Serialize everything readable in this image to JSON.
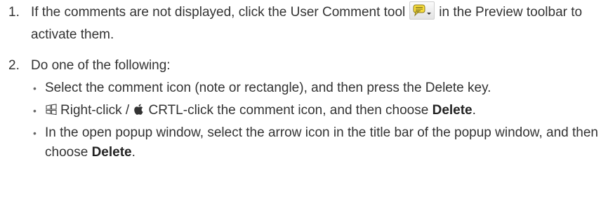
{
  "steps": [
    {
      "number": "1.",
      "text_before_icon": "If the comments are not displayed, click the User Comment tool",
      "text_after_icon": "in the Preview toolbar to activate them."
    },
    {
      "number": "2.",
      "text": "Do one of the following:",
      "bullets": [
        {
          "text": "Select the comment icon (note or rectangle), and then press the Delete key."
        },
        {
          "windows_text": "Right-click /",
          "mac_text": "CRTL-click the comment icon, and then choose",
          "bold": "Delete",
          "tail": "."
        },
        {
          "text": "In the open popup window, select the arrow icon in the title bar of the popup window, and then choose",
          "bold": "Delete",
          "tail": "."
        }
      ]
    }
  ],
  "icons": {
    "user_comment_tool": "user-comment-tool-icon",
    "windows": "windows-logo-icon",
    "apple": "apple-logo-icon"
  },
  "colors": {
    "text": "#333333",
    "note_yellow": "#f7dc3b"
  }
}
